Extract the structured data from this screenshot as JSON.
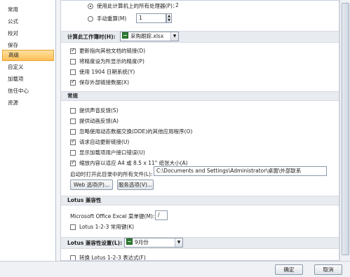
{
  "sidebar": {
    "items": [
      {
        "label": "常用"
      },
      {
        "label": "公式"
      },
      {
        "label": "校对"
      },
      {
        "label": "保存"
      },
      {
        "label": "高级"
      },
      {
        "label": "自定义"
      },
      {
        "label": "加载项"
      },
      {
        "label": "信任中心"
      },
      {
        "label": "资源"
      }
    ],
    "active_index": 4
  },
  "top_options": {
    "radio_all_processors": "使用此计算机上的所有处理器(P)：",
    "processor_count": "2",
    "radio_manual": "手动重算(M)",
    "manual_value": "1"
  },
  "workbook_calc": {
    "header": "计算此工作簿时(H):",
    "workbook_name": "采购跟踪.xlsx",
    "options": [
      {
        "label": "更新指向其他文档的链接(D)",
        "checked": true
      },
      {
        "label": "将精度设为所显示的精度(P)",
        "checked": false
      },
      {
        "label": "使用 1904 日期系统(Y)",
        "checked": false
      },
      {
        "label": "保存外部链接数据(X)",
        "checked": true
      }
    ]
  },
  "general": {
    "header": "常规",
    "options": [
      {
        "label": "提供声音反馈(S)",
        "checked": false
      },
      {
        "label": "提供动画反馈(A)",
        "checked": false
      },
      {
        "label": "忽略使用动态数据交换(DDE)的其他应用程序(O)",
        "checked": false
      },
      {
        "label": "请求自动更新链接(U)",
        "checked": true
      },
      {
        "label": "显示加载项用户接口错误(U)",
        "checked": false
      },
      {
        "label": "缩放内容以适应 A4 或 8.5 x 11\" 纸张大小(A)",
        "checked": true
      }
    ],
    "startup_label": "启动时打开此目录中的所有文件(L):",
    "startup_path": "C:\\Documents and Settings\\Administrator\\桌面\\外部联系",
    "web_options_button": "Web 选项(P)...",
    "service_options_button": "服务选项(V)..."
  },
  "lotus": {
    "header": "Lotus 兼容性",
    "menu_key_label": "Microsoft Office Excel 菜单键(M):",
    "menu_key_value": "/",
    "nav_keys_label": "Lotus 1-2-3 常用键(K)",
    "nav_keys_checked": false
  },
  "lotus_settings": {
    "header": "Lotus 兼容性设置(L):",
    "sheet_name": "9月份",
    "formula_label": "转换 Lotus 1-2-3 表达式(F)",
    "formula_checked": false
  },
  "footer": {
    "ok_button": "确定",
    "cancel_button": "取消"
  }
}
